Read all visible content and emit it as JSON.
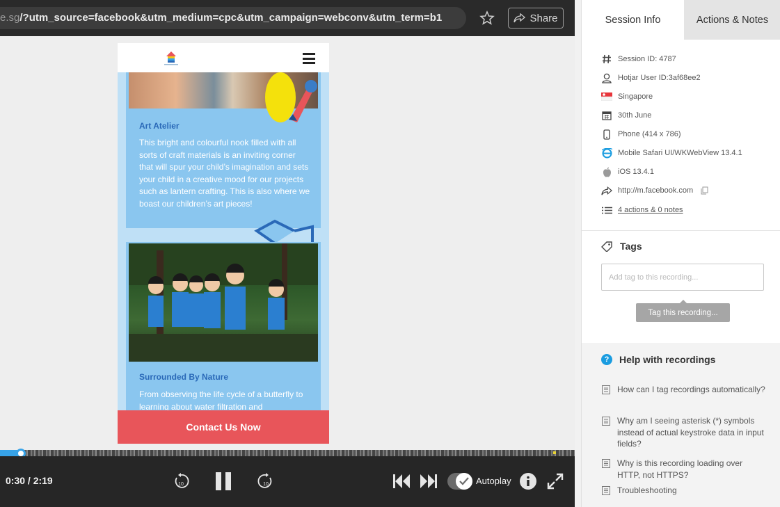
{
  "browser": {
    "url_dim": "e.sg",
    "url_main": "/?utm_source=facebook&utm_medium=cpc&utm_campaign=webconv&utm_term=b1",
    "share_label": "Share"
  },
  "site": {
    "card1": {
      "title": "Art Atelier",
      "text": "This bright and colourful nook filled with all sorts of craft materials is an inviting corner that will spur your child’s imagination and sets your child in a creative mood for our projects such as lantern crafting. This is also where we boast our children’s art pieces!"
    },
    "card2": {
      "title": "Surrounded By Nature",
      "text": "From observing the life cycle of a butterfly to learning about water filtration and"
    },
    "cta": "Contact Us Now"
  },
  "player": {
    "time": "0:30 / 2:19",
    "progress": 0.036,
    "autoplay_label": "Autoplay",
    "autoplay_on": true,
    "skip_back": "10",
    "skip_forward": "10"
  },
  "sidebar": {
    "tabs": [
      "Session Info",
      "Actions & Notes"
    ],
    "info": [
      {
        "icon": "hash-icon",
        "text": "Session ID: 4787"
      },
      {
        "icon": "user-icon",
        "text": "Hotjar User ID:3af68ee2"
      },
      {
        "icon": "flag-icon",
        "text": "Singapore"
      },
      {
        "icon": "calendar-icon",
        "text": "30th June"
      },
      {
        "icon": "phone-icon",
        "text": "Phone (414 x 786)"
      },
      {
        "icon": "browser-icon",
        "text": "Mobile Safari UI/WKWebView 13.4.1"
      },
      {
        "icon": "apple-icon",
        "text": "iOS 13.4.1"
      },
      {
        "icon": "referrer-icon",
        "text": "http://m.facebook.com"
      },
      {
        "icon": "list-icon",
        "text": "4 actions & 0 notes"
      }
    ],
    "tags": {
      "title": "Tags",
      "placeholder": "Add tag to this recording...",
      "button": "Tag this recording..."
    },
    "help": {
      "title": "Help with recordings",
      "items": [
        "How can I tag recordings automatically?",
        "Why am I seeing asterisk (*) symbols instead of actual keystroke data in input fields?",
        "Why is this recording loading over HTTP, not HTTPS?",
        "Troubleshooting"
      ]
    }
  },
  "colors": {
    "accent": "#37a3e8",
    "cta": "#e8555a",
    "card": "#8ac6ef",
    "card_title": "#2a69b8"
  }
}
